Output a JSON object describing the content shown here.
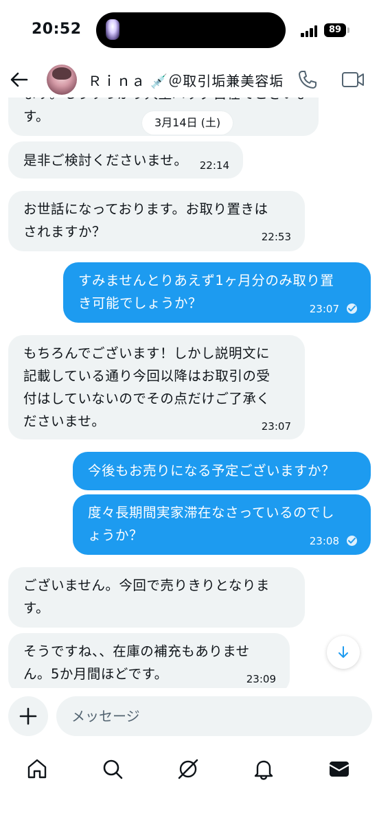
{
  "status_bar": {
    "time": "20:52",
    "battery": "89"
  },
  "header": {
    "contact_name": "Ｒｉｎａ 💉＠取引垢兼美容垢"
  },
  "chat": {
    "partial_top_line": "ます。もうすっかり大型バッグ自在でございます。",
    "date_divider": "3月14日 (土)",
    "messages": [
      {
        "dir": "in",
        "lines": [
          "す。"
        ]
      },
      {
        "dir": "in",
        "lines": [
          "是非ご検討くださいませ。"
        ],
        "time": "22:14"
      },
      {
        "dir": "in",
        "lines": [
          "お世話になっております。お取り置きは",
          "されますか？"
        ],
        "time": "22:53"
      },
      {
        "dir": "out",
        "lines": [
          "すみませんとりあえず1ヶ月分のみ取り置",
          "き可能でしょうか？"
        ],
        "time": "23:07"
      },
      {
        "dir": "in",
        "lines": [
          "もちろんでございます！しかし説明文に",
          "記載している通り今回以降はお取引の受",
          "付はしていないのでその点だけご了承く",
          "ださいませ。"
        ],
        "time": "23:07"
      },
      {
        "dir": "out",
        "lines": [
          "今後もお売りになる予定ございますか？"
        ]
      },
      {
        "dir": "out",
        "lines": [
          "度々長期間実家滞在なさっているのでし",
          "ょうか？"
        ],
        "time": "23:08"
      },
      {
        "dir": "in",
        "lines": [
          "ございません。今回で売りきりとなりま",
          "す。"
        ]
      },
      {
        "dir": "in",
        "lines": [
          "そうですね、、在庫の補充もありませ",
          "ん。5か月間ほどです。"
        ],
        "time": "23:09"
      }
    ]
  },
  "composer": {
    "placeholder": "メッセージ"
  },
  "colors": {
    "accent": "#1d9bf0",
    "incoming_bg": "#eff3f4",
    "text": "#0f1419"
  },
  "icons": {
    "back": "arrow-left-icon",
    "call": "phone-icon",
    "video": "video-camera-icon",
    "scroll": "arrow-down-icon",
    "plus": "plus-icon",
    "nav": [
      "home-icon",
      "search-icon",
      "grok-icon",
      "bell-icon",
      "mail-icon"
    ]
  }
}
